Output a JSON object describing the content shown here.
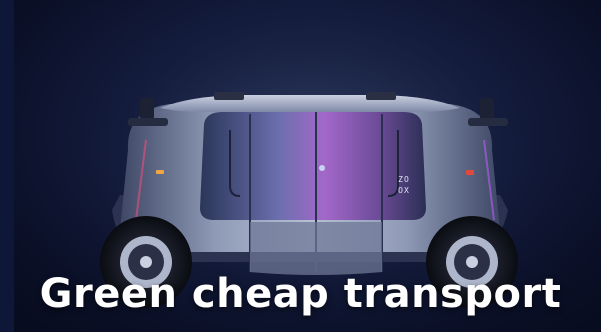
{
  "caption": "Green cheap transport",
  "vehicle_badge": {
    "line1": "ZO",
    "line2": "OX"
  },
  "colors": {
    "background": "#0b1330",
    "caption_text": "#ffffff",
    "cabin_glow": "#9b5fc7",
    "body": "#8e99b5"
  }
}
